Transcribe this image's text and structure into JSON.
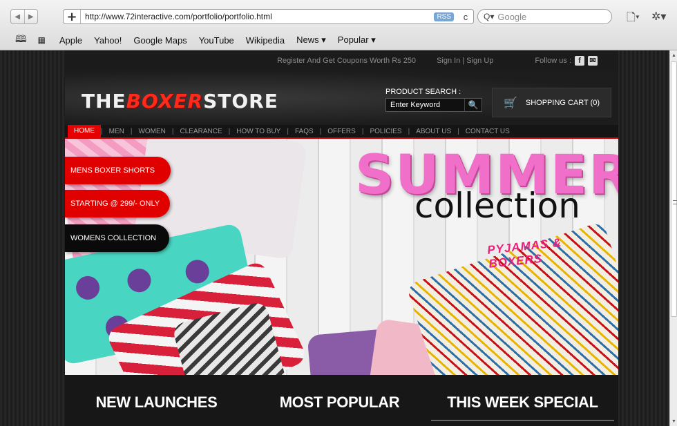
{
  "browser": {
    "back_icon": "◀",
    "forward_icon": "▶",
    "new_tab_icon": "+",
    "url": "http://www.72interactive.com/portfolio/portfolio.html",
    "rss_label": "RSS",
    "reload_icon": "c",
    "search_icon": "Q▾",
    "search_placeholder": "Google",
    "page_menu_icon": "🗋▾",
    "settings_icon": "✲▾",
    "bookmarks": [
      "Apple",
      "Yahoo!",
      "Google Maps",
      "YouTube",
      "Wikipedia",
      "News ▾",
      "Popular ▾"
    ]
  },
  "site": {
    "topbar": {
      "promo": "Register And Get Coupons Worth Rs 250",
      "auth": "Sign In | Sign Up",
      "follow": "Follow us :",
      "fb": "f",
      "mail": "✉"
    },
    "logo": {
      "pre": "THE",
      "mid": "BOXER",
      "post": "STORE"
    },
    "search": {
      "label": "PRODUCT SEARCH :",
      "placeholder": "Enter Keyword",
      "icon": "🔍"
    },
    "cart": {
      "icon": "🛒",
      "label": "SHOPPING CART (0)"
    },
    "nav": [
      "HOME",
      "MEN",
      "WOMEN",
      "CLEARANCE",
      "HOW TO BUY",
      "FAQS",
      "OFFERS",
      "POLICIES",
      "ABOUT US",
      "CONTACT US"
    ],
    "hero": {
      "pill1": "MENS BOXER SHORTS",
      "pill2": "STARTING @ 299/- ONLY",
      "pill3": "WOMENS COLLECTION",
      "headline": "SUMMER",
      "subheadline": "collection",
      "tagline": "PYJAMAS & BOXERS"
    },
    "sections": [
      "NEW LAUNCHES",
      "MOST POPULAR",
      "THIS WEEK SPECIAL"
    ]
  },
  "colors": {
    "accent": "#e10000",
    "headline": "#f06fc8",
    "tagline": "#e8207a"
  }
}
